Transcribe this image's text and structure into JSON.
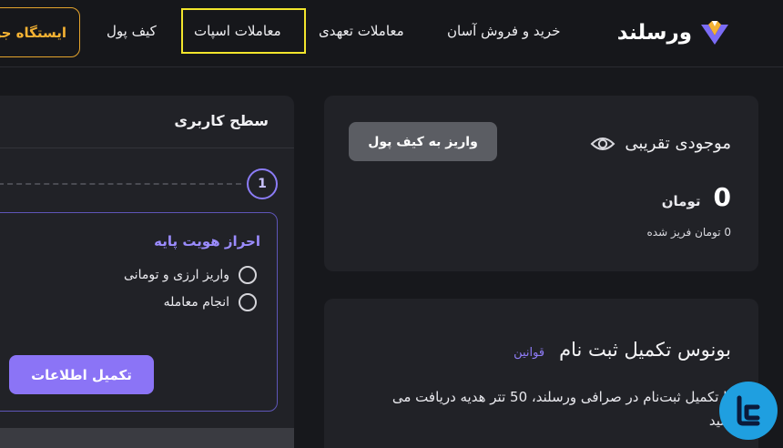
{
  "brand": {
    "name": "ورسلند"
  },
  "nav": {
    "items": [
      {
        "label": "خرید و فروش آسان"
      },
      {
        "label": "معاملات تعهدی"
      },
      {
        "label": "معاملات اسپات"
      },
      {
        "label": "کیف پول"
      }
    ],
    "station_button": "ایستگاه جو"
  },
  "balance": {
    "title": "موجودی تقریبی",
    "deposit_button": "واریز به کیف پول",
    "amount": "0",
    "unit": "تومان",
    "frozen": "0 تومان فریز شده"
  },
  "user_level": {
    "title": "سطح کاربری",
    "step_number": "1",
    "identity_title": "احراز هویت پایه",
    "checklist": [
      {
        "label": "واریز ارزی و تومانی"
      },
      {
        "label": "انجام معامله"
      }
    ],
    "complete_button": "تکمیل اطلاعات"
  },
  "bonus": {
    "title": "بونوس تکمیل ثبت نام",
    "rules_link": "قوانین",
    "description": "با تکمیل ثبت‌نام در صرافی ورسلند، 50 تتر هدیه دریافت می کنید"
  },
  "colors": {
    "background": "#17181c",
    "card": "#212227",
    "accent_purple": "#8b74f6",
    "highlight_yellow": "#f2e52c",
    "station_orange": "#f4b233"
  }
}
